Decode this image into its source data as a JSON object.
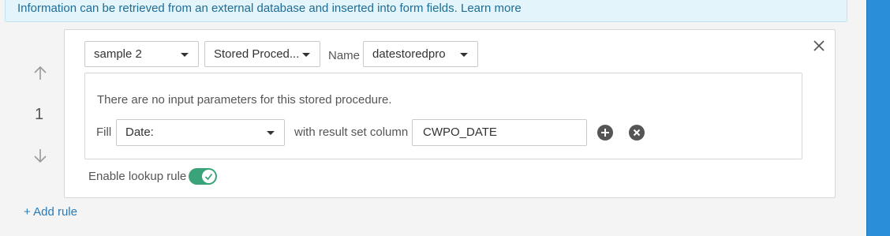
{
  "banner": {
    "text": "Information can be retrieved from an external database and inserted into form fields.",
    "link": "Learn more"
  },
  "rule": {
    "number": "1",
    "source_select": "sample 2",
    "type_select": "Stored Proced...",
    "name_label": "Name",
    "name_select": "datestoredpro",
    "no_params_text": "There are no input parameters for this stored procedure.",
    "fill_label": "Fill",
    "fill_select": "Date:",
    "result_label": "with result set column",
    "result_value": "CWPO_DATE",
    "enable_label": "Enable lookup rule",
    "enabled": true
  },
  "add_rule_label": "+ Add rule",
  "colors": {
    "banner_bg": "#e3f5fb",
    "banner_text": "#1f6c95",
    "toggle_on": "#3aa37a",
    "link": "#2a7ab8",
    "side_bar": "#2a8fd8"
  },
  "icons": [
    "arrow-up-icon",
    "arrow-down-icon",
    "close-icon",
    "plus-circle-icon",
    "remove-circle-icon",
    "check-icon",
    "chevron-down-icon"
  ]
}
